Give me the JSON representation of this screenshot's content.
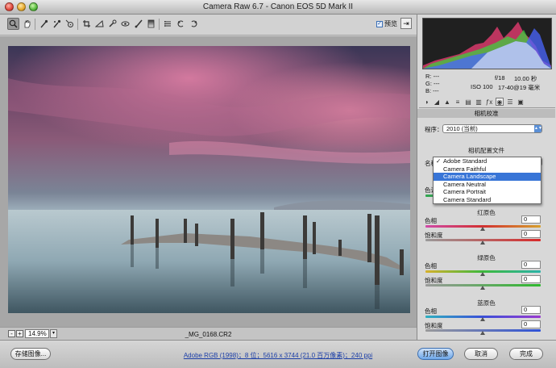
{
  "window": {
    "title": "Camera Raw 6.7  -  Canon EOS 5D Mark II"
  },
  "toolbar": {
    "tools": [
      "zoom-icon",
      "hand-icon",
      "white-balance-icon",
      "color-sampler-icon",
      "target-adjust-icon",
      "crop-icon",
      "straighten-icon",
      "spot-removal-icon",
      "red-eye-icon",
      "adjustment-brush-icon",
      "graduated-filter-icon",
      "preferences-icon",
      "rotate-ccw-icon",
      "rotate-cw-icon"
    ],
    "preview_label": "预览",
    "preview_checked": "✓",
    "fullscreen_glyph": "⇥"
  },
  "status": {
    "zoom_minus": "-",
    "zoom_plus": "+",
    "zoom_value": "14.9%",
    "zoom_arrow": "▾",
    "filename": "_MG_0168.CR2"
  },
  "bottom": {
    "save_label": "存储图像...",
    "workflow_text": "Adobe RGB (1998)；8 位；5616 x 3744 (21.0 百万像素)；240 ppi",
    "open_label": "打开图像",
    "cancel_label": "取消",
    "done_label": "完成"
  },
  "readouts": {
    "r": "R:  ---",
    "g": "G:  ---",
    "b": "B:  ---",
    "aperture": "f/18",
    "shutter": "10.00 秒",
    "iso": "ISO 100",
    "lens": "17-40@19 毫米"
  },
  "panel": {
    "header": "相机校准",
    "process_label": "程序：",
    "process_value": "2010 (当前)",
    "profile_section": "相机配置文件",
    "name_label": "名称",
    "shadows_label": "色调",
    "red_section": "红原色",
    "green_section": "绿原色",
    "blue_section": "蓝原色",
    "hue_label": "色相",
    "saturation_label": "饱和度",
    "red_hue": "0",
    "red_sat": "0",
    "green_hue": "0",
    "green_sat": "0",
    "blue_hue": "0",
    "blue_sat": "0"
  },
  "dropdown": {
    "check": "✓",
    "items": [
      "Adobe Standard",
      "Camera Faithful",
      "Camera Landscape",
      "Camera Neutral",
      "Camera Portrait",
      "Camera Standard"
    ],
    "selected_index": 0,
    "highlighted_index": 2
  },
  "colors": {
    "accent": "#3875d7",
    "link": "#1c3fa8"
  }
}
